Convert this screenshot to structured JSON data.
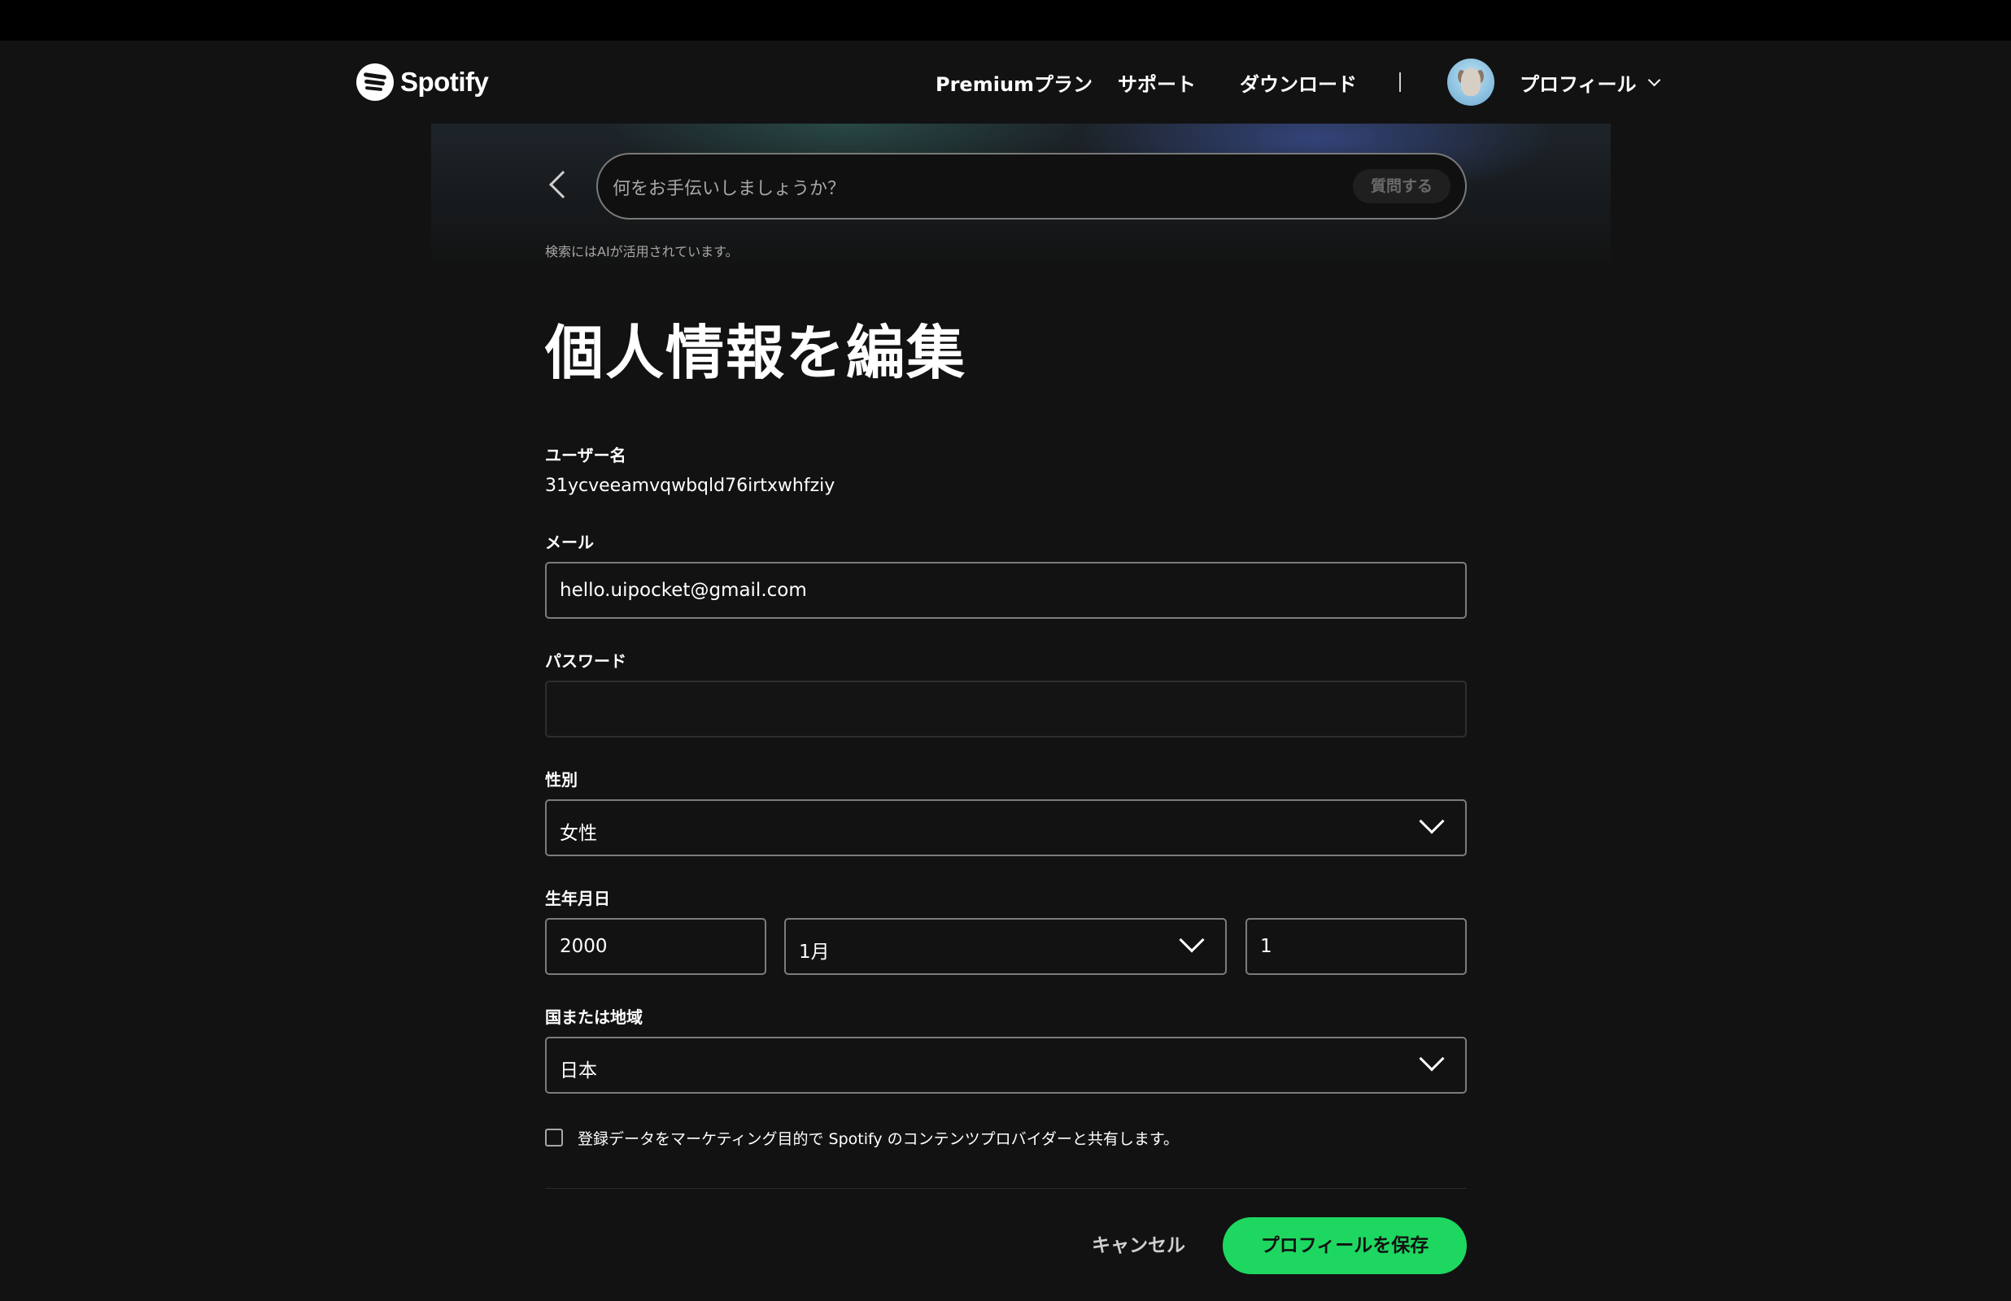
{
  "header": {
    "logo_text": "Spotify",
    "nav": {
      "premium": "Premiumプラン",
      "support": "サポート",
      "download": "ダウンロード",
      "profile": "プロフィール"
    }
  },
  "search": {
    "placeholder": "何をお手伝いしましょうか？",
    "ask_button": "質問する",
    "ai_note": "検索にはAIが活用されています。"
  },
  "page_title": "個人情報を編集",
  "form": {
    "username_label": "ユーザー名",
    "username_value": "31ycveeamvqwbqld76irtxwhfziy",
    "email_label": "メール",
    "email_value": "hello.uipocket@gmail.com",
    "password_label": "パスワード",
    "password_value": "",
    "gender_label": "性別",
    "gender_value": "女性",
    "birthdate_label": "生年月日",
    "birth_year": "2000",
    "birth_month": "1月",
    "birth_day": "1",
    "country_label": "国または地域",
    "country_value": "日本",
    "marketing_checkbox_label": "登録データをマーケティング目的で Spotify のコンテンツプロバイダーと共有します。",
    "marketing_checked": false
  },
  "actions": {
    "cancel": "キャンセル",
    "save": "プロフィールを保存"
  },
  "colors": {
    "background": "#121212",
    "accent": "#1ed760",
    "text": "#ffffff",
    "muted": "#a7a7a7"
  }
}
